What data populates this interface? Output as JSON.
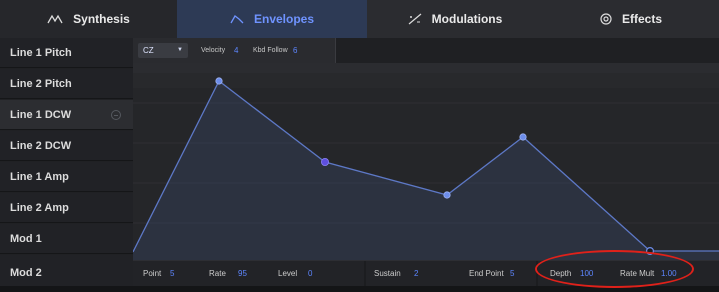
{
  "tabs": {
    "synthesis": "Synthesis",
    "envelopes": "Envelopes",
    "modulations": "Modulations",
    "effects": "Effects"
  },
  "sidebar": {
    "items": [
      {
        "label": "Line 1 Pitch"
      },
      {
        "label": "Line 2 Pitch"
      },
      {
        "label": "Line 1 DCW"
      },
      {
        "label": "Line 2 DCW"
      },
      {
        "label": "Line 1 Amp"
      },
      {
        "label": "Line 2 Amp"
      },
      {
        "label": "Mod 1"
      },
      {
        "label": "Mod 2"
      }
    ]
  },
  "envelope_bar": {
    "mode": "CZ",
    "velocity_label": "Velocity",
    "velocity_value": "4",
    "kbd_follow_label": "Kbd Follow",
    "kbd_follow_value": "6"
  },
  "params": {
    "point_label": "Point",
    "point_value": "5",
    "rate_label": "Rate",
    "rate_value": "95",
    "level_label": "Level",
    "level_value": "0",
    "sustain_label": "Sustain",
    "sustain_value": "2",
    "end_point_label": "End Point",
    "end_point_value": "5",
    "depth_label": "Depth",
    "depth_value": "100",
    "rate_mult_label": "Rate Mult",
    "rate_mult_value": "1.00"
  },
  "colors": {
    "accent": "#5d86ff",
    "highlight": "#e0211a"
  }
}
